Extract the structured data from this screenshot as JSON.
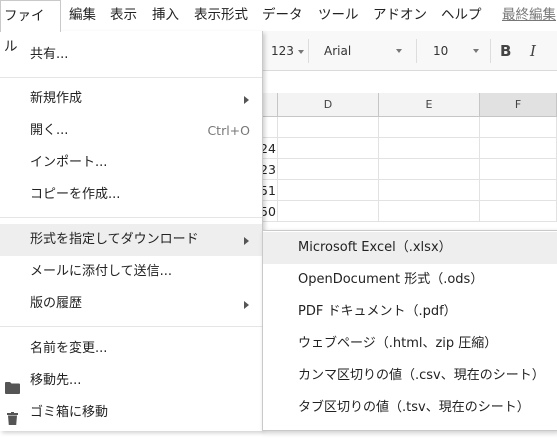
{
  "menubar": {
    "items": [
      "ファイル",
      "編集",
      "表示",
      "挿入",
      "表示形式",
      "データ",
      "ツール",
      "アドオン",
      "ヘルプ"
    ],
    "last_edit": "最終編集"
  },
  "toolbar": {
    "number_format": "123",
    "font": "Arial",
    "font_size": "10",
    "bold": "B",
    "italic": "I"
  },
  "grid": {
    "columns": [
      "D",
      "E",
      "F"
    ],
    "partial_values": [
      "24",
      "23",
      "51",
      "50"
    ]
  },
  "file_menu": {
    "share": "共有...",
    "new": "新規作成",
    "open": "開く...",
    "open_shortcut": "Ctrl+O",
    "import": "インポート...",
    "make_copy": "コピーを作成...",
    "download_as": "形式を指定してダウンロード",
    "email_attachment": "メールに添付して送信...",
    "version_history": "版の履歴",
    "rename": "名前を変更...",
    "move_to": "移動先...",
    "move_to_trash": "ゴミ箱に移動"
  },
  "download_submenu": {
    "items": [
      "Microsoft Excel（.xlsx）",
      "OpenDocument 形式（.ods）",
      "PDF ドキュメント（.pdf）",
      "ウェブページ（.html、zip 圧縮）",
      "カンマ区切りの値（.csv、現在のシート）",
      "タブ区切りの値（.tsv、現在のシート）"
    ]
  }
}
